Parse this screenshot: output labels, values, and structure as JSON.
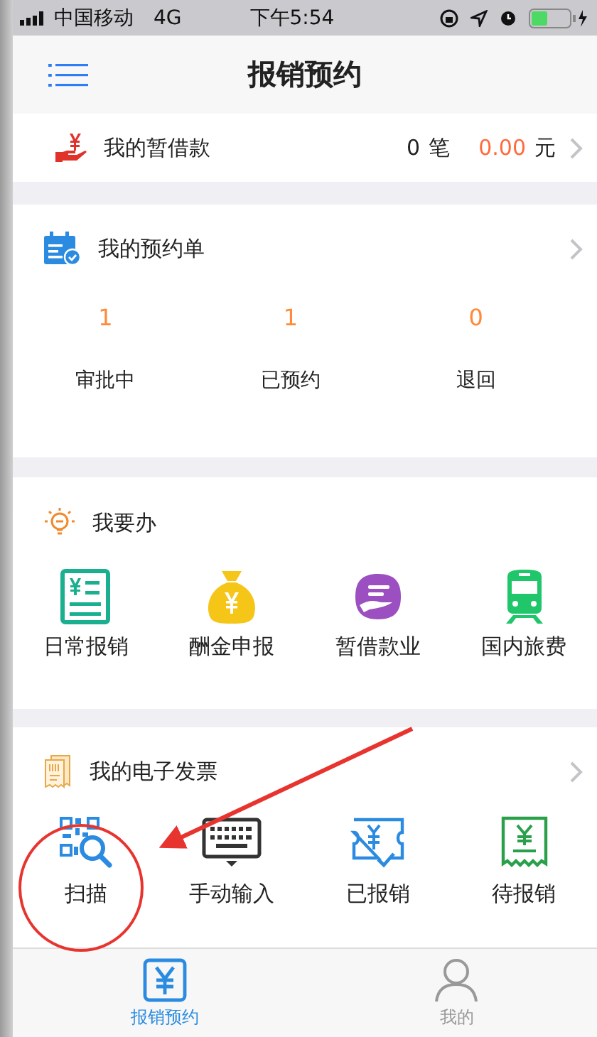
{
  "status_bar": {
    "carrier": "中国移动",
    "network": "4G",
    "time": "下午5:54"
  },
  "nav": {
    "title": "报销预约"
  },
  "loan": {
    "label": "我的暂借款",
    "count": "0",
    "count_unit": "笔",
    "amount": "0.00",
    "amount_unit": "元"
  },
  "reservations": {
    "title": "我的预约单",
    "stats": [
      {
        "value": "1",
        "label": "审批中"
      },
      {
        "value": "1",
        "label": "已预约"
      },
      {
        "value": "0",
        "label": "退回"
      }
    ]
  },
  "todo": {
    "title": "我要办",
    "items": [
      {
        "kind": "daily",
        "label": "日常报销"
      },
      {
        "kind": "pay",
        "label": "酬金申报"
      },
      {
        "kind": "loan",
        "label": "暂借款业"
      },
      {
        "kind": "travel",
        "label": "国内旅费"
      }
    ]
  },
  "invoices": {
    "title": "我的电子发票",
    "actions": [
      {
        "kind": "scan",
        "label": "扫描"
      },
      {
        "kind": "keyboard",
        "label": "手动输入"
      },
      {
        "kind": "done",
        "label": "已报销"
      },
      {
        "kind": "pending",
        "label": "待报销"
      }
    ]
  },
  "tab_bar": [
    {
      "kind": "reimburse",
      "label": "报销预约",
      "selected": true
    },
    {
      "kind": "me",
      "label": "我的",
      "selected": false
    }
  ],
  "annotations": [
    {
      "kind": "circle"
    },
    {
      "kind": "arrow"
    }
  ]
}
